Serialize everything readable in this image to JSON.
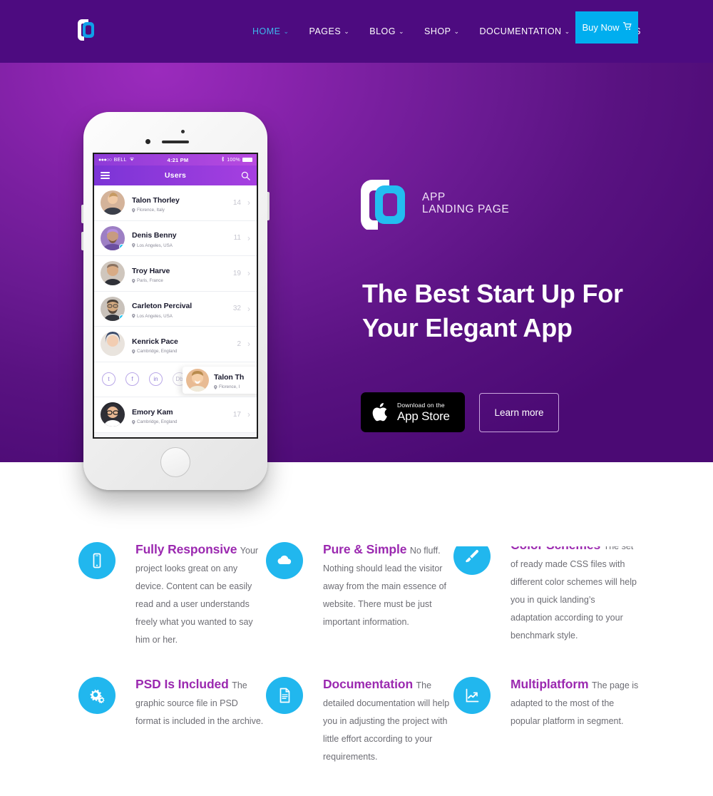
{
  "site": {
    "brand_purple": "#4d0b80",
    "accent_cyan": "#00aeef",
    "heading_purple": "#9b29b0"
  },
  "header": {
    "logo_icon": "app-logo-icon",
    "nav": [
      {
        "label": "HOME",
        "caret": "⌄",
        "active": true
      },
      {
        "label": "PAGES",
        "caret": "⌄",
        "active": false
      },
      {
        "label": "BLOG",
        "caret": "⌄",
        "active": false
      },
      {
        "label": "SHOP",
        "caret": "⌄",
        "active": false
      },
      {
        "label": "DOCUMENTATION",
        "caret": "⌄",
        "active": false
      },
      {
        "label": "ELEMENTS",
        "caret": "",
        "active": false
      }
    ],
    "cta": {
      "label": "Buy Now",
      "icon": "shopping-cart-icon",
      "glyph": "🛒"
    }
  },
  "hero": {
    "logo_icon": "app-logo-icon",
    "caption_line1": "APP",
    "caption_line2": "LANDING PAGE",
    "title_line1": "The Best Start Up For",
    "title_line2": "Your Elegant App",
    "appstore": {
      "icon": "apple-logo-icon",
      "small_label": "Download on the",
      "big_label": "App Store"
    },
    "learn_more": "Learn more"
  },
  "phone": {
    "status": {
      "signal_dots": "●●●○○",
      "carrier": "BELL",
      "wifi_icon": "wifi-icon",
      "time": "4:21 PM",
      "bluetooth_icon": "bluetooth-icon",
      "battery_percent": "100%"
    },
    "appbar": {
      "menu_icon": "hamburger-menu-icon",
      "title": "Users",
      "search_icon": "search-icon"
    },
    "users": [
      {
        "name": "Talon Thorley",
        "location": "Florence, Italy",
        "count": "14",
        "online": false,
        "avatar": "#d4b39a"
      },
      {
        "name": "Denis Benny",
        "location": "Los Angeles, USA",
        "count": "11",
        "online": true,
        "avatar": "#9d7fc4"
      },
      {
        "name": "Troy Harve",
        "location": "Paris, France",
        "count": "19",
        "online": false,
        "avatar": "#8d7f73"
      },
      {
        "name": "Carleton Percival",
        "location": "Los Angeles, USA",
        "count": "32",
        "online": true,
        "avatar": "#7c6f66"
      },
      {
        "name": "Kenrick Pace",
        "location": "Cambridge, England",
        "count": "2",
        "online": false,
        "avatar": "#6e6f8c"
      }
    ],
    "social": [
      {
        "name": "twitter-icon",
        "glyph": "t",
        "muted": false
      },
      {
        "name": "facebook-icon",
        "glyph": "f",
        "muted": false
      },
      {
        "name": "linkedin-icon",
        "glyph": "in",
        "muted": false
      },
      {
        "name": "dribbble-icon",
        "glyph": "Db",
        "muted": true
      }
    ],
    "float_card": {
      "name": "Talon Th",
      "location": "Florence, I",
      "avatar": "#e8bb93"
    },
    "last_user": {
      "name": "Emory Kam",
      "location": "Cambridge, England",
      "count": "17",
      "online": false,
      "avatar": "#3a3a42"
    }
  },
  "features": {
    "row1": [
      {
        "icon": "mobile-phone-icon",
        "title": "Fully Responsive",
        "text": "Your project looks great on any device. Content can be easily read and a user understands freely what you wanted to say him or her."
      },
      {
        "icon": "cloud-icon",
        "title": "Pure & Simple",
        "text": "No fluff. Nothing should lead the visitor away from the main essence of website. There must be just important information."
      },
      {
        "icon": "paint-brush-icon",
        "title": "Color Schemes",
        "text": "The set of ready made CSS files with different color schemes will help you in quick landing’s adaptation according to your benchmark style."
      }
    ],
    "row2": [
      {
        "icon": "gears-icon",
        "title": "PSD Is Included",
        "text": "The graphic source file in PSD format is included in the archive."
      },
      {
        "icon": "document-icon",
        "title": "Documentation",
        "text": "The detailed documentation will help you in adjusting the project with little effort according to your requirements."
      },
      {
        "icon": "line-chart-icon",
        "title": "Multiplatform",
        "text": "The page is adapted to the most of the popular platform in segment."
      }
    ]
  }
}
